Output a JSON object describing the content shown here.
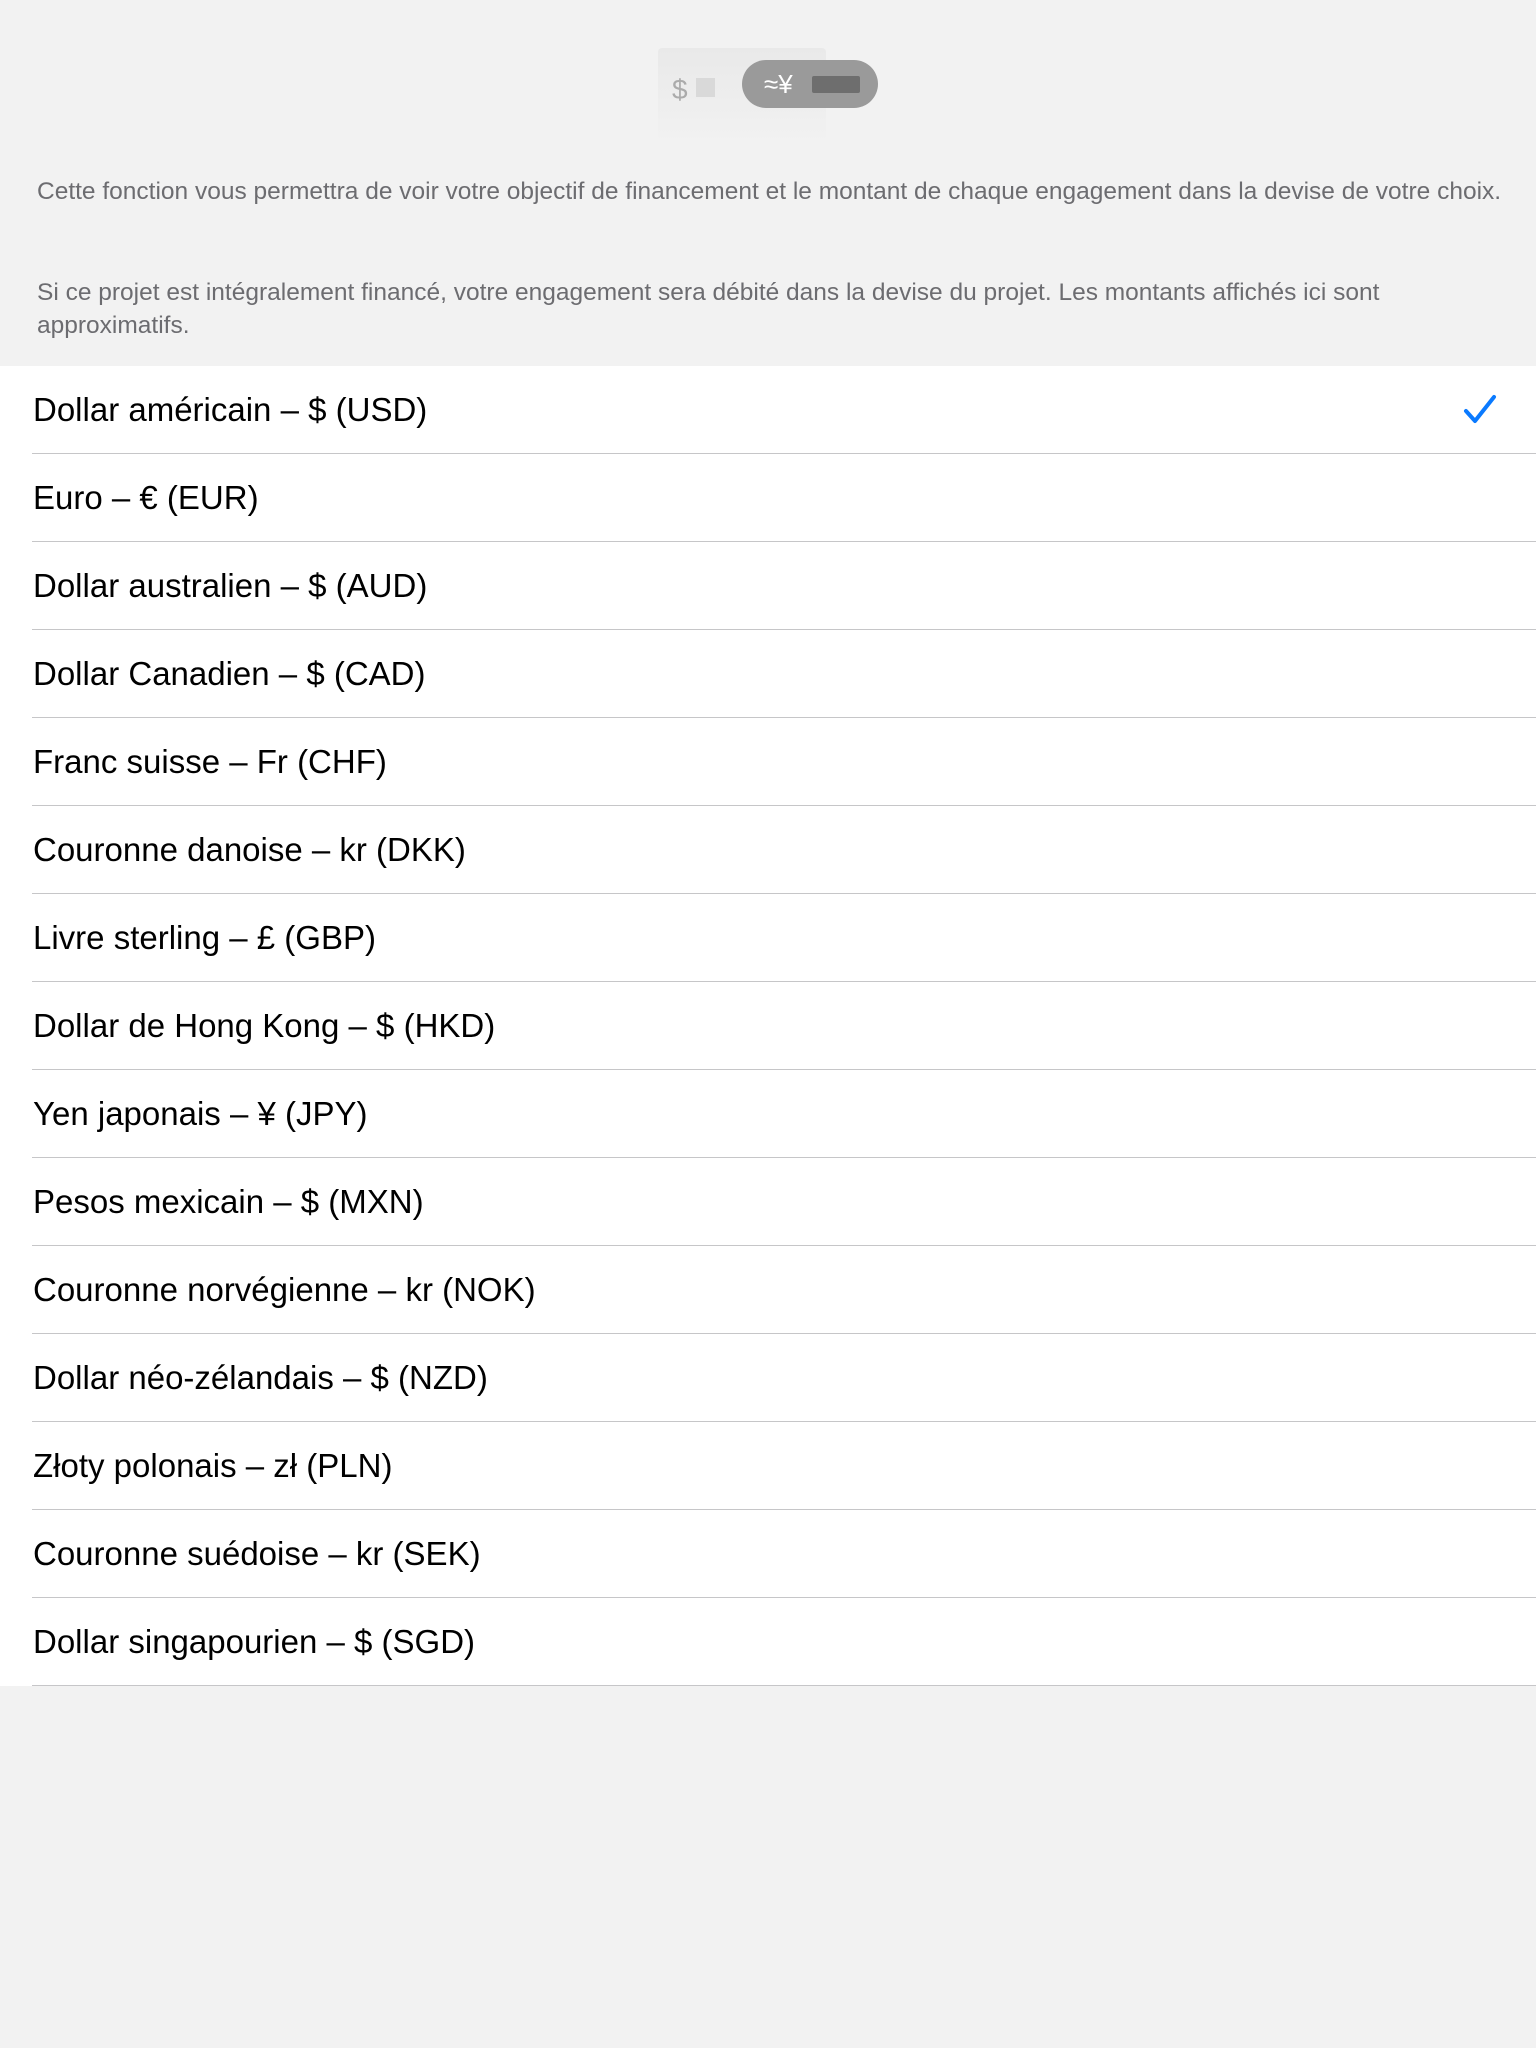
{
  "illustration": {
    "left_symbol": "$",
    "pill_symbol": "≈¥"
  },
  "description": {
    "paragraph_1": "Cette fonction vous permettra de voir votre objectif de financement et le montant de chaque engagement dans la devise de votre choix.",
    "paragraph_2": "Si ce projet est intégralement financé, votre engagement sera débité dans la devise du projet. Les montants affichés ici sont approximatifs."
  },
  "currencies": [
    {
      "label": "Dollar américain – $ (USD)",
      "selected": true
    },
    {
      "label": "Euro – € (EUR)",
      "selected": false
    },
    {
      "label": "Dollar australien – $ (AUD)",
      "selected": false
    },
    {
      "label": "Dollar Canadien – $ (CAD)",
      "selected": false
    },
    {
      "label": "Franc suisse – Fr (CHF)",
      "selected": false
    },
    {
      "label": "Couronne danoise – kr (DKK)",
      "selected": false
    },
    {
      "label": "Livre sterling – £ (GBP)",
      "selected": false
    },
    {
      "label": "Dollar de Hong Kong – $ (HKD)",
      "selected": false
    },
    {
      "label": "Yen japonais – ¥ (JPY)",
      "selected": false
    },
    {
      "label": "Pesos mexicain – $ (MXN)",
      "selected": false
    },
    {
      "label": "Couronne norvégienne – kr (NOK)",
      "selected": false
    },
    {
      "label": "Dollar néo-zélandais – $ (NZD)",
      "selected": false
    },
    {
      "label": "Złoty polonais – zł (PLN)",
      "selected": false
    },
    {
      "label": "Couronne suédoise – kr (SEK)",
      "selected": false
    },
    {
      "label": "Dollar singapourien – $ (SGD)",
      "selected": false
    }
  ],
  "colors": {
    "accent": "#0a7aff",
    "background": "#f2f2f2",
    "row_background": "#ffffff",
    "separator": "#c6c6c8",
    "secondary_text": "#6c6c70"
  },
  "icons": {
    "selected_marker": "checkmark-icon"
  }
}
